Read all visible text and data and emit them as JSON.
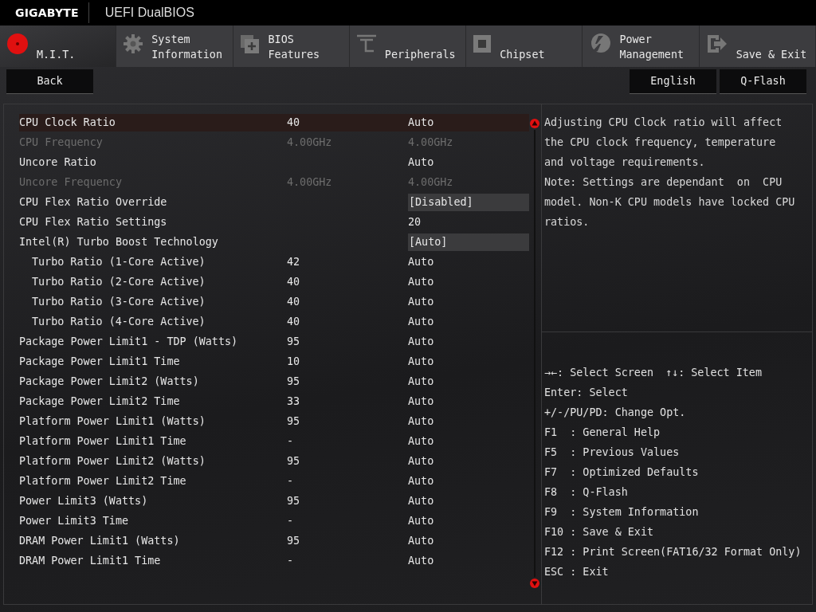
{
  "header": {
    "brand": "GIGABYTE",
    "title": "UEFI DualBIOS"
  },
  "tabs": [
    {
      "line2": "M.I.T.",
      "selected": true
    },
    {
      "line1": "System",
      "line2": "Information",
      "selected": false
    },
    {
      "line1": "BIOS",
      "line2": "Features",
      "selected": false
    },
    {
      "line2": "Peripherals",
      "selected": false
    },
    {
      "line2": "Chipset",
      "selected": false
    },
    {
      "line1": "Power",
      "line2": "Management",
      "selected": false
    },
    {
      "line2": "Save & Exit",
      "selected": false
    }
  ],
  "back_button": "Back",
  "right_buttons": [
    "English",
    "Q-Flash"
  ],
  "settings": [
    {
      "label": "CPU Clock Ratio",
      "value": "40",
      "setting": "Auto",
      "kind": "plain",
      "disabled": false,
      "selected": true
    },
    {
      "label": "CPU Frequency",
      "value": "4.00GHz",
      "setting": "4.00GHz",
      "kind": "plain",
      "disabled": true,
      "selected": false
    },
    {
      "label": "Uncore Ratio",
      "setting": "Auto",
      "kind": "plain",
      "disabled": false,
      "selected": false
    },
    {
      "label": "Uncore Frequency",
      "value": "4.00GHz",
      "setting": "4.00GHz",
      "kind": "plain",
      "disabled": true,
      "selected": false
    },
    {
      "label": "CPU Flex Ratio Override",
      "setting": "[Disabled]",
      "kind": "dropdown",
      "disabled": false,
      "selected": false
    },
    {
      "label": "CPU Flex Ratio Settings",
      "setting": "20",
      "kind": "plain",
      "disabled": false,
      "selected": false
    },
    {
      "label": "Intel(R) Turbo Boost Technology",
      "setting": "[Auto]",
      "kind": "dropdown",
      "disabled": false,
      "selected": false,
      "children": [
        {
          "label": "Turbo Ratio (1-Core Active)",
          "value": "42",
          "setting": "Auto",
          "kind": "plain",
          "disabled": false,
          "selected": false
        },
        {
          "label": "Turbo Ratio (2-Core Active)",
          "value": "40",
          "setting": "Auto",
          "kind": "plain",
          "disabled": false,
          "selected": false
        },
        {
          "label": "Turbo Ratio (3-Core Active)",
          "value": "40",
          "setting": "Auto",
          "kind": "plain",
          "disabled": false,
          "selected": false
        },
        {
          "label": "Turbo Ratio (4-Core Active)",
          "value": "40",
          "setting": "Auto",
          "kind": "plain",
          "disabled": false,
          "selected": false
        }
      ]
    },
    {
      "label": "Package Power Limit1 - TDP (Watts)",
      "value": "95",
      "setting": "Auto",
      "kind": "plain",
      "disabled": false,
      "selected": false
    },
    {
      "label": "Package Power Limit1 Time",
      "value": "10",
      "setting": "Auto",
      "kind": "plain",
      "disabled": false,
      "selected": false
    },
    {
      "label": "Package Power Limit2 (Watts)",
      "value": "95",
      "setting": "Auto",
      "kind": "plain",
      "disabled": false,
      "selected": false
    },
    {
      "label": "Package Power Limit2 Time",
      "value": "33",
      "setting": "Auto",
      "kind": "plain",
      "disabled": false,
      "selected": false
    },
    {
      "label": "Platform Power Limit1 (Watts)",
      "value": "95",
      "setting": "Auto",
      "kind": "plain",
      "disabled": false,
      "selected": false
    },
    {
      "label": "Platform Power Limit1 Time",
      "value": "-",
      "setting": "Auto",
      "kind": "plain",
      "disabled": false,
      "selected": false
    },
    {
      "label": "Platform Power Limit2 (Watts)",
      "value": "95",
      "setting": "Auto",
      "kind": "plain",
      "disabled": false,
      "selected": false
    },
    {
      "label": "Platform Power Limit2 Time",
      "value": "-",
      "setting": "Auto",
      "kind": "plain",
      "disabled": false,
      "selected": false
    },
    {
      "label": "Power Limit3 (Watts)",
      "value": "95",
      "setting": "Auto",
      "kind": "plain",
      "disabled": false,
      "selected": false
    },
    {
      "label": "Power Limit3 Time",
      "value": "-",
      "setting": "Auto",
      "kind": "plain",
      "disabled": false,
      "selected": false
    },
    {
      "label": "DRAM Power Limit1 (Watts)",
      "value": "95",
      "setting": "Auto",
      "kind": "plain",
      "disabled": false,
      "selected": false
    },
    {
      "label": "DRAM Power Limit1 Time",
      "value": "-",
      "setting": "Auto",
      "kind": "plain",
      "disabled": false,
      "selected": false
    }
  ],
  "help_text": [
    "Adjusting CPU Clock ratio will affect",
    "the CPU clock frequency, temperature",
    "and voltage requirements.",
    "Note: Settings are dependant  on  CPU",
    "model. Non-K CPU models have locked CPU",
    "ratios."
  ],
  "key_help": [
    [
      "→←: Select Screen",
      "↑↓: Select Item"
    ],
    [
      "Enter: Select"
    ],
    [
      "+/-/PU/PD: Change Opt."
    ],
    [
      "F1  : General Help"
    ],
    [
      "F5  : Previous Values"
    ],
    [
      "F7  : Optimized Defaults"
    ],
    [
      "F8  : Q-Flash"
    ],
    [
      "F9  : System Information"
    ],
    [
      "F10 : Save & Exit"
    ],
    [
      "F12 : Print Screen(FAT16/32 Format Only)"
    ],
    [
      "ESC : Exit"
    ]
  ]
}
